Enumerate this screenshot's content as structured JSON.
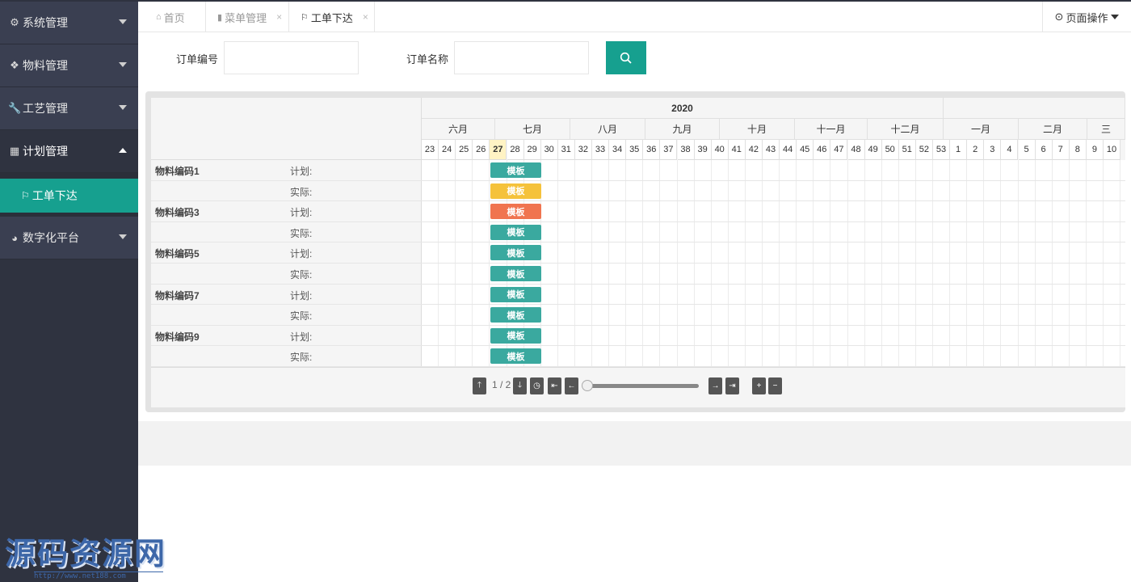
{
  "sidebar": {
    "items": [
      {
        "icon": "gears-icon",
        "glyph": "⚙",
        "label": "系统管理"
      },
      {
        "icon": "cubes-icon",
        "glyph": "❖",
        "label": "物料管理"
      },
      {
        "icon": "wrench-icon",
        "glyph": "🔧",
        "label": "工艺管理"
      },
      {
        "icon": "calendar-icon",
        "glyph": "▦",
        "label": "计划管理"
      },
      {
        "icon": "pie-chart-icon",
        "glyph": "◕",
        "label": "数字化平台"
      }
    ],
    "sub_item": "工单下达",
    "accent": "#16a08f"
  },
  "watermark": {
    "text": "源码资源网",
    "url": "http://www.net188.com"
  },
  "tabs": [
    {
      "icon": "home-icon",
      "glyph": "⌂",
      "label": "首页"
    },
    {
      "icon": "bookmark-icon",
      "glyph": "▮",
      "label": "菜单管理",
      "close": "×"
    },
    {
      "icon": "flag-icon",
      "glyph": "⚐",
      "label": "工单下达",
      "close": "×"
    }
  ],
  "page_ops": {
    "glyph": "⊙",
    "label": "页面操作"
  },
  "search": {
    "order_no_label": "订单编号",
    "order_no_value": "",
    "order_no_placeholder": "",
    "order_name_label": "订单名称",
    "order_name_value": "",
    "order_name_placeholder": ""
  },
  "gantt": {
    "year": "2020",
    "months": [
      "六月",
      "七月",
      "八月",
      "九月",
      "十月",
      "十一月",
      "十二月",
      "一月",
      "二月",
      "三"
    ],
    "weeks": [
      "23",
      "24",
      "25",
      "26",
      "27",
      "28",
      "29",
      "30",
      "31",
      "32",
      "33",
      "34",
      "35",
      "36",
      "37",
      "38",
      "39",
      "40",
      "41",
      "42",
      "43",
      "44",
      "45",
      "46",
      "47",
      "48",
      "49",
      "50",
      "51",
      "52",
      "53",
      "1",
      "2",
      "3",
      "4",
      "5",
      "6",
      "7",
      "8",
      "9",
      "10"
    ],
    "current_week": "27",
    "rows": [
      {
        "name": "物料编码1",
        "type": "计划:",
        "bar": "模板",
        "color": "#3aa99f"
      },
      {
        "name": "",
        "type": "实际:",
        "bar": "模板",
        "color": "#f5c23b"
      },
      {
        "name": "物料编码3",
        "type": "计划:",
        "bar": "模板",
        "color": "#f0744f"
      },
      {
        "name": "",
        "type": "实际:",
        "bar": "模板",
        "color": "#3aa99f"
      },
      {
        "name": "物料编码5",
        "type": "计划:",
        "bar": "模板",
        "color": "#3aa99f"
      },
      {
        "name": "",
        "type": "实际:",
        "bar": "模板",
        "color": "#3aa99f"
      },
      {
        "name": "物料编码7",
        "type": "计划:",
        "bar": "模板",
        "color": "#3aa99f"
      },
      {
        "name": "",
        "type": "实际:",
        "bar": "模板",
        "color": "#3aa99f"
      },
      {
        "name": "物料编码9",
        "type": "计划:",
        "bar": "模板",
        "color": "#3aa99f"
      },
      {
        "name": "",
        "type": "实际:",
        "bar": "模板",
        "color": "#3aa99f"
      }
    ],
    "nav": {
      "page": "1 / 2",
      "zoom_level": 0
    }
  }
}
